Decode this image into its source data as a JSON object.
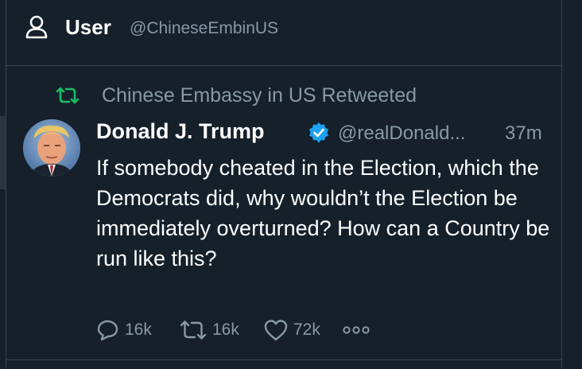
{
  "header": {
    "title": "User",
    "handle": "@ChineseEmbinUS"
  },
  "retweet": {
    "label": "Chinese Embassy in US Retweeted"
  },
  "tweet": {
    "display_name": "Donald J. Trump",
    "handle": "@realDonald...",
    "time": "37m",
    "text": "If somebody cheated in the Election, which the Democrats did, why wouldn’t the Election be immediately overturned? How can a Country be run like this?",
    "replies": "16k",
    "retweets": "16k",
    "likes": "72k"
  },
  "colors": {
    "background": "#15202b",
    "secondary_text": "#8899a6",
    "retweet_green": "#17bf63",
    "verified_blue": "#1da1f2",
    "divider": "#38444d"
  },
  "icons": [
    "user-icon",
    "retweet-icon",
    "verified-badge-icon",
    "reply-icon",
    "retweet-action-icon",
    "like-icon",
    "more-icon"
  ]
}
